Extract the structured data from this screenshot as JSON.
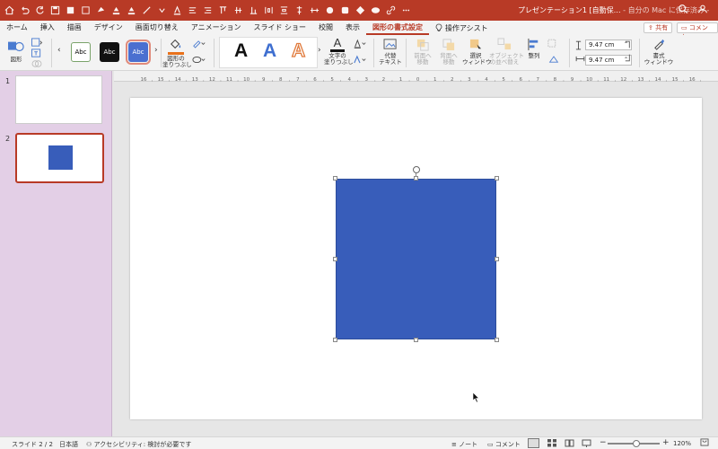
{
  "titlebar": {
    "doc_title": "プレゼンテーション1 [自動保…",
    "doc_sub": " - 自分の Mac に保存済み -"
  },
  "tabs": [
    {
      "label": "ホーム"
    },
    {
      "label": "挿入"
    },
    {
      "label": "描画"
    },
    {
      "label": "デザイン"
    },
    {
      "label": "画面切り替え"
    },
    {
      "label": "アニメーション"
    },
    {
      "label": "スライド ショー"
    },
    {
      "label": "校閲"
    },
    {
      "label": "表示"
    },
    {
      "label": "図形の書式設定",
      "active": true
    },
    {
      "label": "操作アシスト"
    }
  ],
  "share": {
    "label": "共有"
  },
  "comment": {
    "label": "コメント"
  },
  "ribbon": {
    "shapes_label": "図形",
    "style_abc": "Abc",
    "fill_label": "図形の\n塗りつぶし",
    "text_fill_label": "文字の\n塗りつぶし",
    "alt_text_label": "代替\nテキスト",
    "bring_forward": "前面へ\n移動",
    "send_backward": "背面へ\n移動",
    "selection_pane": "選択\nウィンドウ",
    "reorder": "オブジェクト\nの並べ替え",
    "align": "整列",
    "height": "9.47 cm",
    "width": "9.47 cm",
    "format_pane": "書式\nウィンドウ",
    "wordart_letter": "A"
  },
  "ruler": {
    "labels": [
      "16",
      "15",
      "14",
      "13",
      "12",
      "11",
      "10",
      "9",
      "8",
      "7",
      "6",
      "5",
      "4",
      "3",
      "2",
      "1",
      "0",
      "1",
      "2",
      "3",
      "4",
      "5",
      "6",
      "7",
      "8",
      "9",
      "10",
      "11",
      "12",
      "13",
      "14",
      "15",
      "16"
    ]
  },
  "slides": [
    {
      "number": "1"
    },
    {
      "number": "2"
    }
  ],
  "statusbar": {
    "slide_counter": "スライド 2 / 2",
    "language": "日本語",
    "accessibility": "アクセシビリティ: 検討が必要です",
    "notes": "ノート",
    "comments": "コメント",
    "zoom": "120%"
  },
  "colors": {
    "accent": "#b83a26",
    "shape_fill": "#385dba",
    "pane_bg": "#e3cfe6"
  },
  "zoom_slider_value": 0.55
}
